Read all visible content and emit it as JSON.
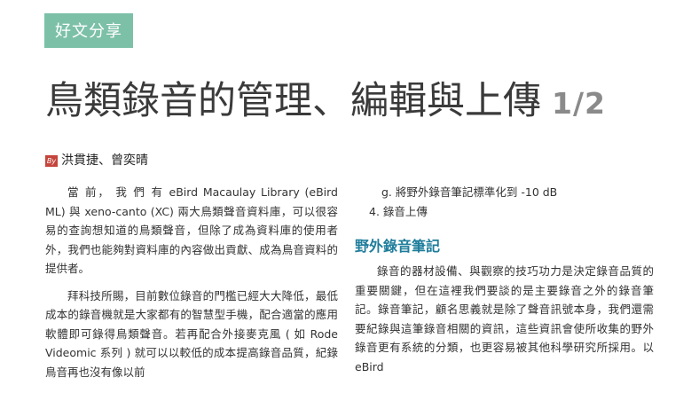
{
  "section_tab": "好文分享",
  "title": {
    "main": "鳥類錄音的管理、編輯與上傳",
    "part": "1/2"
  },
  "byline": {
    "badge": "By",
    "authors": "洪貫捷、曾奕晴"
  },
  "left_column": {
    "paragraphs": [
      "當 前， 我 們 有 eBird Macaulay Library (eBird ML) 與 xeno-canto (XC) 兩大鳥類聲音資料庫，可以很容易的查詢想知道的鳥類聲音，但除了成為資料庫的使用者外，我們也能夠對資料庫的內容做出貢獻、成為鳥音資料的提供者。",
      "拜科技所賜，目前數位錄音的門檻已經大大降低，最低成本的錄音機就是大家都有的智慧型手機，配合適當的應用軟體即可錄得鳥類聲音。若再配合外接麥克風 ( 如 Rode Videomic 系列 ) 就可以以較低的成本提高錄音品質，紀錄鳥音再也沒有像以前"
    ]
  },
  "right_column": {
    "list_item_g": "g. 將野外錄音筆記標準化到 -10 dB",
    "list_item_4": "4. 錄音上傳",
    "subheading": "野外錄音筆記",
    "paragraph": "錄音的器材設備、與觀察的技巧功力是決定錄音品質的重要關鍵，但在這裡我們要談的是主要錄音之外的錄音筆記。錄音筆記，顧名思義就是除了聲音訊號本身，我們還需要紀錄與這筆錄音相關的資訊，這些資訊會使所收集的野外錄音更有系統的分類，也更容易被其他科學研究所採用。以 eBird"
  }
}
